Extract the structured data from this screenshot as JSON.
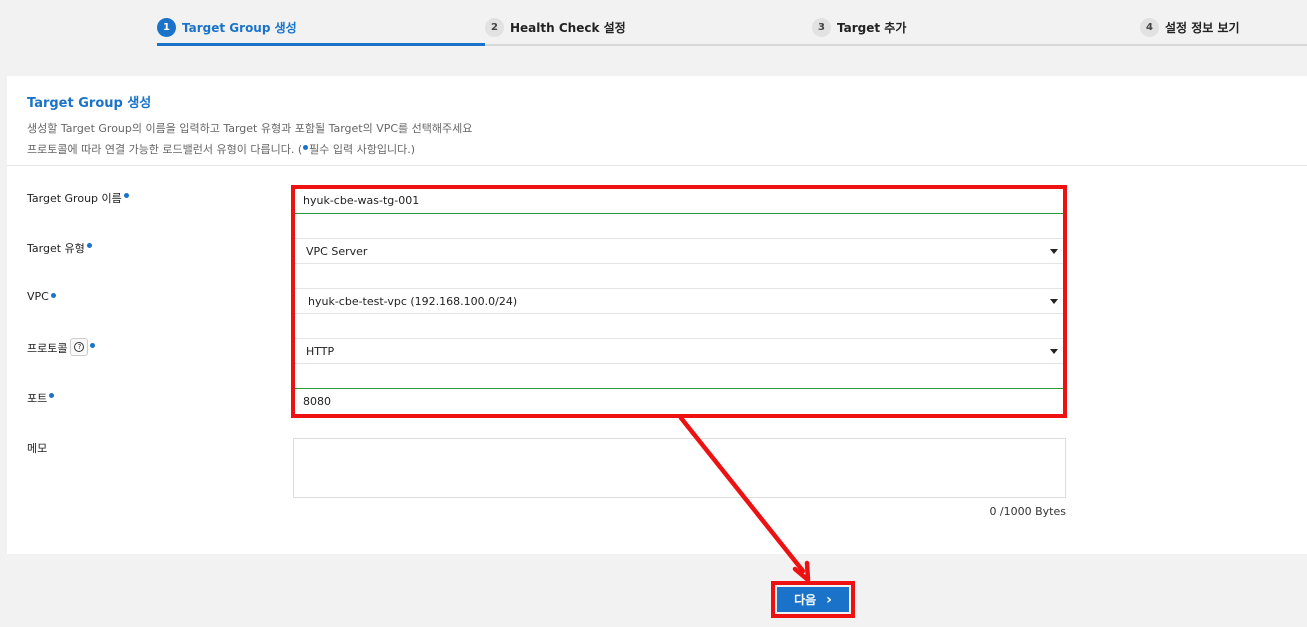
{
  "stepper": {
    "steps": [
      {
        "num": "1",
        "label": "Target Group 생성"
      },
      {
        "num": "2",
        "label": "Health Check 설정"
      },
      {
        "num": "3",
        "label": "Target 추가"
      },
      {
        "num": "4",
        "label": "설정 정보 보기"
      }
    ]
  },
  "panel": {
    "title": "Target Group 생성",
    "desc_line1": "생성할 Target Group의 이름을 입력하고 Target 유형과 포함될 Target의 VPC를 선택해주세요",
    "desc_line2_pre": "프로토콜에 따라 연결 가능한 로드밸런서 유형이 다릅니다. (",
    "desc_line2_post": "필수 입력 사항입니다.)"
  },
  "form": {
    "name_label": "Target Group 이름",
    "name_value": "hyuk-cbe-was-tg-001",
    "type_label": "Target 유형",
    "type_value": "VPC Server",
    "vpc_label": "VPC",
    "vpc_value": "hyuk-cbe-test-vpc (192.168.100.0/24)",
    "protocol_label": "프로토콜",
    "protocol_value": "HTTP",
    "port_label": "포트",
    "port_value": "8080",
    "memo_label": "메모",
    "memo_value": "",
    "byte_count": "0 /1000 Bytes"
  },
  "next_button": {
    "label": "다음",
    "icon": "chevron-right-icon"
  },
  "colors": {
    "accent": "#1a73c9",
    "highlight": "#ee1111",
    "valid": "#2e9a3e"
  }
}
